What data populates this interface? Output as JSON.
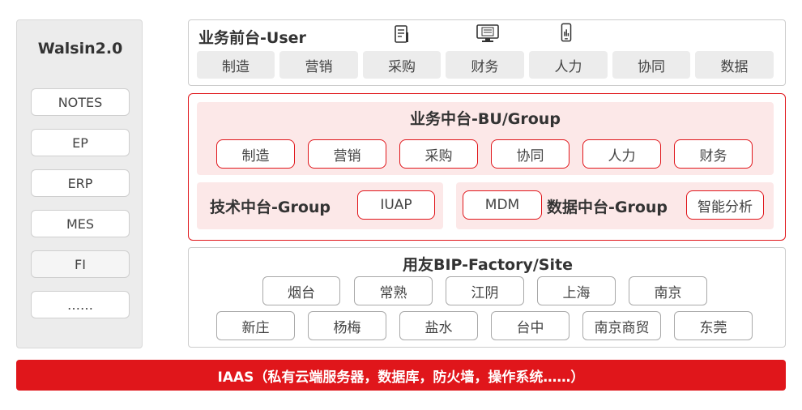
{
  "sidebar": {
    "title": "Walsin2.0",
    "items": [
      "NOTES",
      "EP",
      "ERP",
      "MES",
      "FI",
      "……"
    ]
  },
  "user_layer": {
    "title": "业务前台-User",
    "icons": [
      "document-icon",
      "monitor-icon",
      "phone-icon"
    ],
    "items": [
      "制造",
      "营销",
      "采购",
      "财务",
      "人力",
      "协同",
      "数据"
    ]
  },
  "bu_layer": {
    "title": "业务中台-BU/Group",
    "items": [
      "制造",
      "营销",
      "采购",
      "协同",
      "人力",
      "财务"
    ],
    "tech": {
      "title": "技术中台-Group",
      "item": "IUAP"
    },
    "data": {
      "prefix": "MDM",
      "title": "数据中台-Group",
      "item": "智能分析"
    }
  },
  "factory_layer": {
    "title": "用友BIP-Factory/Site",
    "row1": [
      "烟台",
      "常熟",
      "江阴",
      "上海",
      "南京"
    ],
    "row2": [
      "新庄",
      "杨梅",
      "盐水",
      "台中",
      "南京商贸",
      "东莞"
    ]
  },
  "iaas": {
    "label": "IAAS（私有云端服务器，数据库，防火墙，操作系统……）"
  },
  "colors": {
    "accent": "#e0161b",
    "pink": "#fce8e8",
    "gray": "#ececec"
  }
}
